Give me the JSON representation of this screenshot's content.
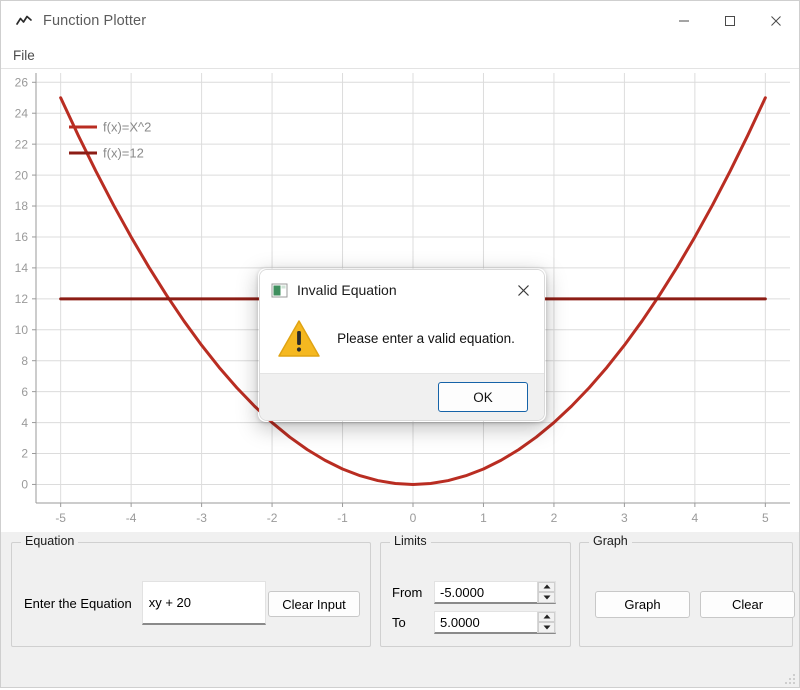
{
  "window": {
    "title": "Function Plotter",
    "icon": "line-chart-icon",
    "controls": {
      "minimize": "–",
      "maximize": "□",
      "close": "✕"
    }
  },
  "menubar": {
    "items": [
      {
        "label": "File"
      }
    ]
  },
  "equation_group": {
    "title": "Equation",
    "input_label": "Enter the Equation",
    "input_value": "xy + 20",
    "input_placeholder": "",
    "clear_input_label": "Clear Input"
  },
  "limits_group": {
    "title": "Limits",
    "from_label": "From",
    "from_value": "-5.0000",
    "to_label": "To",
    "to_value": "5.0000"
  },
  "graph_group": {
    "title": "Graph",
    "graph_label": "Graph",
    "clear_label": "Clear"
  },
  "dialog": {
    "title": "Invalid Equation",
    "icon": "app-window-icon",
    "warning_icon": "warning-triangle-icon",
    "message": "Please enter a valid equation.",
    "ok_label": "OK",
    "close_label": "✕"
  },
  "colors": {
    "curve": "#b92d22",
    "constant_line": "#8c1d15",
    "grid": "#dcdcdc",
    "axis": "#9a9a9a",
    "tick_text": "#9a9a9a",
    "warning": "#f2b01e",
    "focus": "#1663a8",
    "panel": "#f0f0f0"
  },
  "chart_data": {
    "type": "line",
    "title": "",
    "xlabel": "",
    "ylabel": "",
    "xlim": [
      -5.35,
      5.35
    ],
    "ylim": [
      -1.2,
      26.6
    ],
    "grid": true,
    "legend_position": "upper-left-inside",
    "xticks": [
      -5,
      -4,
      -3,
      -2,
      -1,
      0,
      1,
      2,
      3,
      4,
      5
    ],
    "yticks": [
      0,
      2,
      4,
      6,
      8,
      10,
      12,
      14,
      16,
      18,
      20,
      22,
      24,
      26
    ],
    "xtick_labels": [
      "-5",
      "-4",
      "-3",
      "-2",
      "-1",
      "0",
      "1",
      "2",
      "3",
      "4",
      "5"
    ],
    "ytick_labels": [
      "0",
      "2",
      "4",
      "6",
      "8",
      "10",
      "12",
      "14",
      "16",
      "18",
      "20",
      "22",
      "24",
      "26"
    ],
    "series": [
      {
        "name": "f(x)=X^2",
        "color": "#b92d22",
        "x": [
          -5,
          -4.75,
          -4.5,
          -4.25,
          -4,
          -3.75,
          -3.5,
          -3.25,
          -3,
          -2.75,
          -2.5,
          -2.25,
          -2,
          -1.75,
          -1.5,
          -1.25,
          -1,
          -0.75,
          -0.5,
          -0.25,
          0,
          0.25,
          0.5,
          0.75,
          1,
          1.25,
          1.5,
          1.75,
          2,
          2.25,
          2.5,
          2.75,
          3,
          3.25,
          3.5,
          3.75,
          4,
          4.25,
          4.5,
          4.75,
          5
        ],
        "y": [
          25,
          22.5625,
          20.25,
          18.0625,
          16,
          14.0625,
          12.25,
          10.5625,
          9,
          7.5625,
          6.25,
          5.0625,
          4,
          3.0625,
          2.25,
          1.5625,
          1,
          0.5625,
          0.25,
          0.0625,
          0,
          0.0625,
          0.25,
          0.5625,
          1,
          1.5625,
          2.25,
          3.0625,
          4,
          5.0625,
          6.25,
          7.5625,
          9,
          10.5625,
          12.25,
          14.0625,
          16,
          18.0625,
          20.25,
          22.5625,
          25
        ]
      },
      {
        "name": "f(x)=12",
        "color": "#8c1d15",
        "x": [
          -5,
          5
        ],
        "y": [
          12,
          12
        ]
      }
    ]
  }
}
